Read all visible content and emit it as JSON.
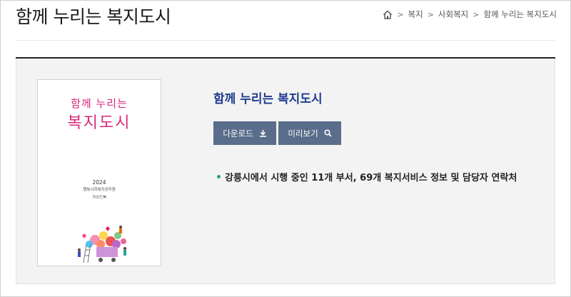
{
  "page": {
    "title": "함께 누리는 복지도시"
  },
  "breadcrumb": {
    "items": [
      "복지",
      "사회복지",
      "함께 누리는 복지도시"
    ],
    "separator": ">"
  },
  "book": {
    "title": "함께 누리는 복지도시",
    "cover": {
      "line1": "함께 누리는",
      "line2": "복지도시",
      "year": "2024",
      "subtitle": "행복시회복지공무원",
      "guide": "가이드북"
    },
    "description": "강릉시에서 시행 중인 11개 부서, 69개 복지서비스 정보 및 담당자 연락처"
  },
  "actions": {
    "download_label": "다운로드",
    "preview_label": "미리보기"
  },
  "colors": {
    "accent_title": "#1f3a8f",
    "button_bg": "#5a6d8a",
    "cover_pink": "#d8287a",
    "bullet": "#2a9d8f"
  },
  "icons": {
    "home": "home-icon",
    "download": "download-icon",
    "search": "search-icon"
  }
}
